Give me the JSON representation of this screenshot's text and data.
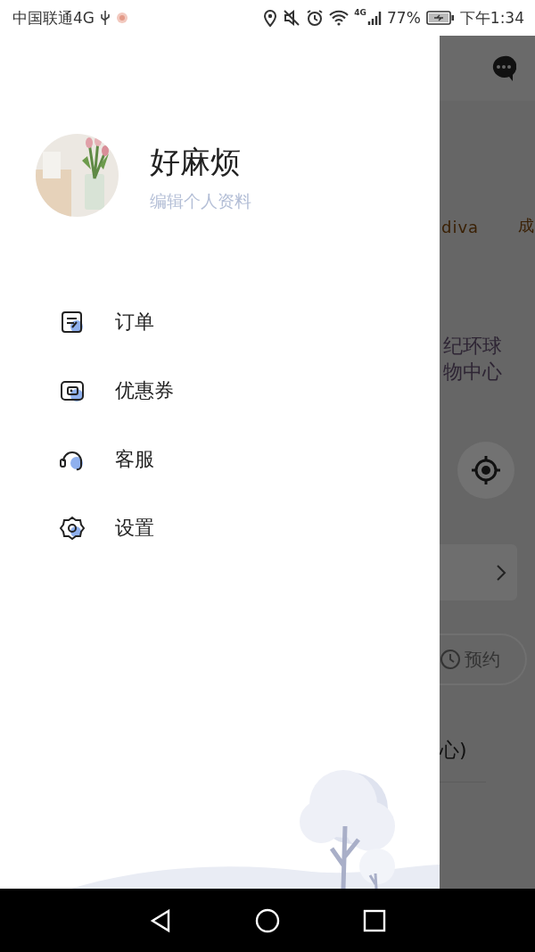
{
  "status_bar": {
    "carrier": "中国联通4G",
    "network": "4G",
    "battery": "77%",
    "time": "下午1:34"
  },
  "drawer": {
    "profile": {
      "name": "好麻烦",
      "edit_link": "编辑个人资料"
    },
    "menu": [
      {
        "kind": "orders",
        "label": "订单"
      },
      {
        "kind": "coupons",
        "label": "优惠券"
      },
      {
        "kind": "service",
        "label": "客服"
      },
      {
        "kind": "settings",
        "label": "设置"
      }
    ]
  },
  "background": {
    "tags": [
      "diva",
      "成"
    ],
    "place": [
      "纪环球",
      "物中心"
    ],
    "reserve_button": "预约",
    "address": "心)"
  }
}
